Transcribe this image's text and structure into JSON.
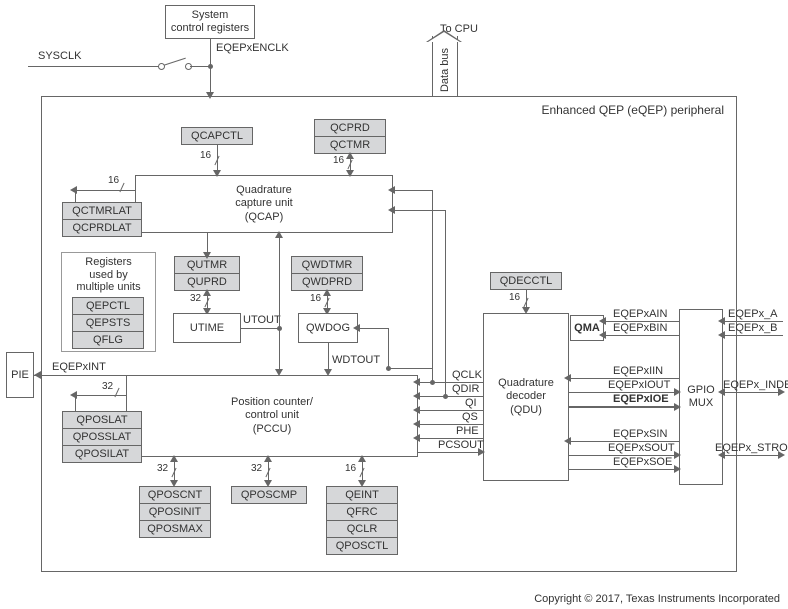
{
  "peripheral_title": "Enhanced QEP (eQEP) peripheral",
  "external": {
    "sysclk": "SYSCLK",
    "to_cpu": "To CPU",
    "data_bus": "Data bus",
    "pie": "PIE",
    "eqepxint": "EQEPxINT",
    "sys_ctrl_reg": "System\ncontrol registers",
    "eqepxenclk": "EQEPxENCLK"
  },
  "blocks": {
    "qcap": {
      "title": "Quadrature\ncapture unit\n(QCAP)"
    },
    "pccu": {
      "title": "Position counter/\ncontrol unit\n(PCCU)"
    },
    "qdu": {
      "title": "Quadrature\ndecoder\n(QDU)"
    },
    "utime": "UTIME",
    "qwdog": "QWDOG",
    "qma": "QMA",
    "gpio_mux": "GPIO\nMUX",
    "regs_box_title": "Registers\nused by\nmultiple units"
  },
  "registers": {
    "qcapctl": "QCAPCTL",
    "qcprd": "QCPRD",
    "qctmr": "QCTMR",
    "qctmrlat": "QCTMRLAT",
    "qcprdlat": "QCPRDLAT",
    "qutmr": "QUTMR",
    "quprd": "QUPRD",
    "qwdtmr": "QWDTMR",
    "qwdprd": "QWDPRD",
    "qdecctl": "QDECCTL",
    "qepctl": "QEPCTL",
    "qepsts": "QEPSTS",
    "qflg": "QFLG",
    "qposlat": "QPOSLAT",
    "qposslat": "QPOSSLAT",
    "qposilat": "QPOSILAT",
    "qposcnt": "QPOSCNT",
    "qposinit": "QPOSINIT",
    "qposmax": "QPOSMAX",
    "qposcmp": "QPOSCMP",
    "qeint": "QEINT",
    "qfrc": "QFRC",
    "qclr": "QCLR",
    "qposctl": "QPOSCTL"
  },
  "signals": {
    "utout": "UTOUT",
    "wdtout": "WDTOUT",
    "qclk": "QCLK",
    "qdir": "QDIR",
    "qi": "QI",
    "qs": "QS",
    "phe": "PHE",
    "pcsout": "PCSOUT",
    "eqepxain": "EQEPxAIN",
    "eqepxbin": "EQEPxBIN",
    "eqepxiin": "EQEPxIIN",
    "eqepxiout": "EQEPxIOUT",
    "eqepxioe": "EQEPxIOE",
    "eqepxsin": "EQEPxSIN",
    "eqepxsout": "EQEPxSOUT",
    "eqepxsoe": "EQEPxSOE",
    "eqepx_a": "EQEPx_A",
    "eqepx_b": "EQEPx_B",
    "eqepx_index": "EQEPx_INDEX",
    "eqepx_strobe": "EQEPx_STROBE"
  },
  "widths": {
    "w16": "16",
    "w32": "32"
  },
  "copyright": "Copyright © 2017, Texas Instruments Incorporated"
}
